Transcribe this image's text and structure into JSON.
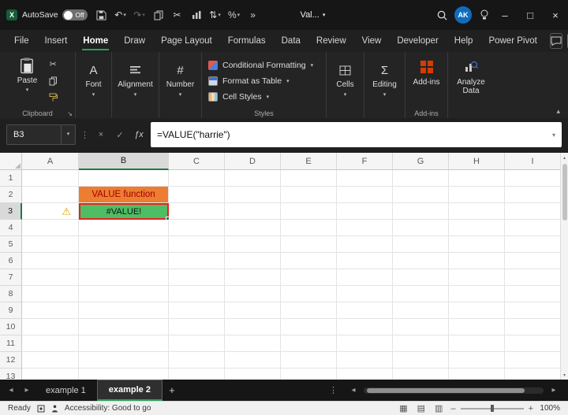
{
  "icons": {
    "chevron_down": "▾",
    "chevron_up": "▴",
    "undo": "↶",
    "redo": "↷",
    "cut": "✂",
    "sort": "⇅",
    "percent": "%",
    "more": "»",
    "minimize": "–",
    "maximize": "□",
    "close": "×",
    "dots_v": "⋮",
    "cancel": "×",
    "check": "✓",
    "fx": "ƒx",
    "warning": "⚠",
    "nav_left": "◂",
    "nav_right": "▸",
    "plus": "+",
    "launcher": "↘",
    "font_a": "A",
    "hash": "#",
    "sigma": "Σ",
    "view_normal": "▦",
    "view_layout": "▤",
    "view_break": "▥",
    "minus": "–"
  },
  "colors": {
    "accent_green": "#2e9e5a",
    "addins_orange": "#d83b01",
    "b2_fill": "#ED7D31",
    "b2_text": "#A00000",
    "b3_fill": "#4DBE63",
    "b3_border": "#E52222",
    "avatar_bg": "#0F6CBD"
  },
  "titlebar": {
    "autosave_label": "AutoSave",
    "autosave_state": "Off",
    "doc_title": "Val...",
    "avatar_initials": "AK"
  },
  "ribbon_tabs": [
    "File",
    "Insert",
    "Home",
    "Draw",
    "Page Layout",
    "Formulas",
    "Data",
    "Review",
    "View",
    "Developer",
    "Help",
    "Power Pivot"
  ],
  "active_tab": "Home",
  "ribbon": {
    "paste_label": "Paste",
    "clipboard_group": "Clipboard",
    "font_label": "Font",
    "alignment_label": "Alignment",
    "number_label": "Number",
    "styles": {
      "items": [
        "Conditional Formatting",
        "Format as Table",
        "Cell Styles"
      ],
      "group_label": "Styles"
    },
    "cells_label": "Cells",
    "editing_label": "Editing",
    "addins_button": "Add-ins",
    "addins_group": "Add-ins",
    "analyze_label": "Analyze Data"
  },
  "formula_bar": {
    "name_box": "B3",
    "formula": "=VALUE(\"harrie\")"
  },
  "grid": {
    "columns": [
      "A",
      "B",
      "C",
      "D",
      "E",
      "F",
      "G",
      "H",
      "I"
    ],
    "rows": [
      "1",
      "2",
      "3",
      "4",
      "5",
      "6",
      "7",
      "8",
      "9",
      "10",
      "11",
      "12",
      "13"
    ],
    "selected_column": "B",
    "selected_row": "3",
    "cells": {
      "b2_text": "VALUE function",
      "b3_text": "#VALUE!"
    }
  },
  "sheet_tabs": {
    "tabs": [
      "example 1",
      "example 2"
    ],
    "active": "example 2"
  },
  "status_bar": {
    "ready": "Ready",
    "accessibility": "Accessibility: Good to go",
    "zoom": "100%"
  }
}
